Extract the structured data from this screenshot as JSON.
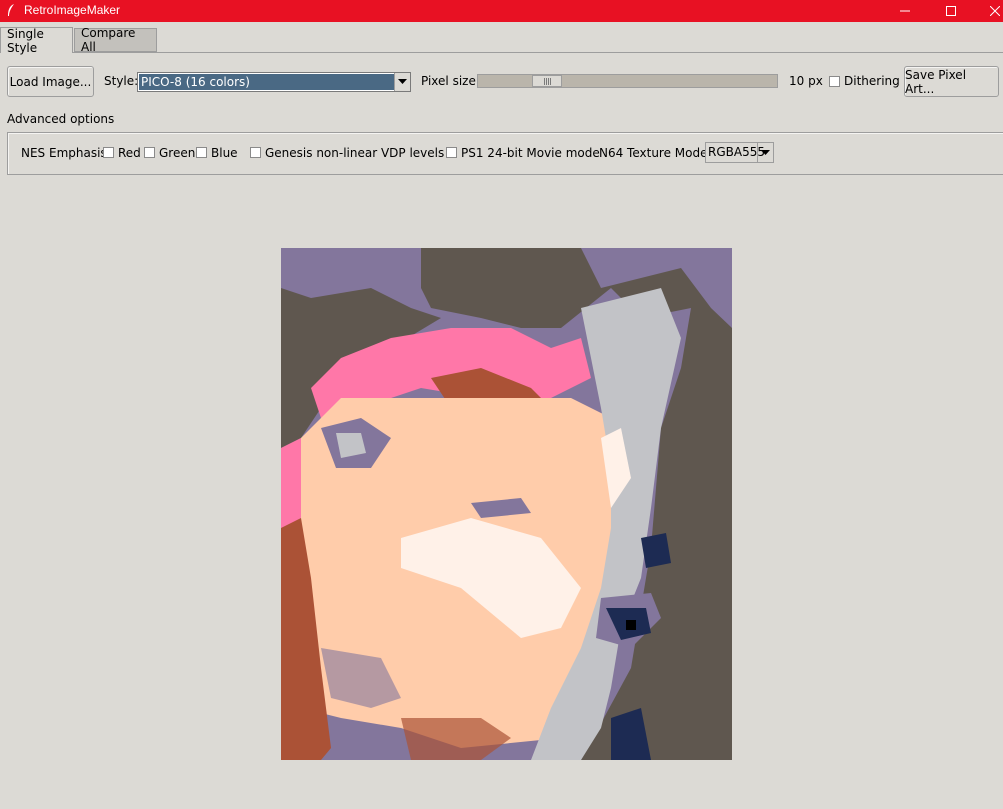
{
  "window": {
    "title": "RetroImageMaker"
  },
  "tabs": [
    {
      "label": "Single Style",
      "active": true
    },
    {
      "label": "Compare All",
      "active": false
    }
  ],
  "toolbar": {
    "load_label": "Load Image...",
    "style_label": "Style:",
    "style_value": "PICO-8 (16 colors)",
    "pixel_size_label": "Pixel size:",
    "pixel_size_value": "10 px",
    "pixel_size_level": 0.2,
    "dithering_label": "Dithering",
    "dithering_checked": false,
    "save_label": "Save Pixel Art..."
  },
  "advanced": {
    "label": "Advanced options",
    "nes_label": "NES Emphasis:",
    "red_label": "Red",
    "green_label": "Green",
    "blue_label": "Blue",
    "genesis_label": "Genesis non-linear VDP levels",
    "ps1_label": "PS1 24-bit Movie mode",
    "n64_label": "N64 Texture Mode:",
    "n64_value": "RGBA555"
  },
  "colors": {
    "titlebar": "#e81123",
    "selection": "#4a6984",
    "background": "#dcdad5"
  }
}
